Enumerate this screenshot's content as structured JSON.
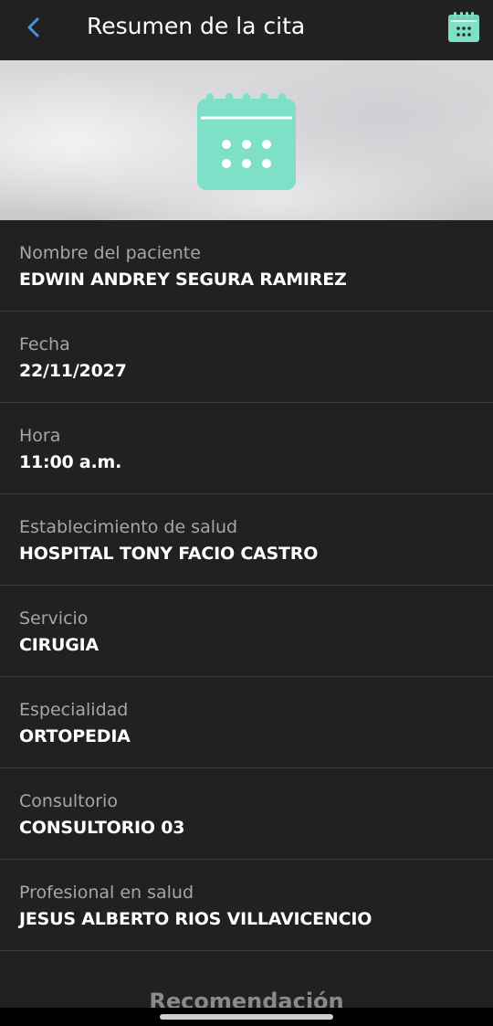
{
  "header": {
    "title": "Resumen de la cita",
    "back_icon": "chevron-left-icon",
    "calendar_icon": "calendar-icon"
  },
  "banner": {
    "icon": "calendar-icon"
  },
  "fields": [
    {
      "label": "Nombre del paciente",
      "value": "EDWIN ANDREY SEGURA RAMIREZ"
    },
    {
      "label": "Fecha",
      "value": "22/11/2027"
    },
    {
      "label": "Hora",
      "value": "11:00 a.m."
    },
    {
      "label": "Establecimiento de salud",
      "value": "HOSPITAL TONY FACIO CASTRO"
    },
    {
      "label": "Servicio",
      "value": "CIRUGIA"
    },
    {
      "label": "Especialidad",
      "value": "ORTOPEDIA"
    },
    {
      "label": "Consultorio",
      "value": "CONSULTORIO 03"
    },
    {
      "label": "Profesional en salud",
      "value": "JESUS ALBERTO RIOS VILLAVICENCIO"
    }
  ],
  "recommendation": {
    "heading": "Recomendación"
  },
  "colors": {
    "accent": "#7fe0c8",
    "back_chevron": "#4a90e2",
    "background": "#212121"
  }
}
